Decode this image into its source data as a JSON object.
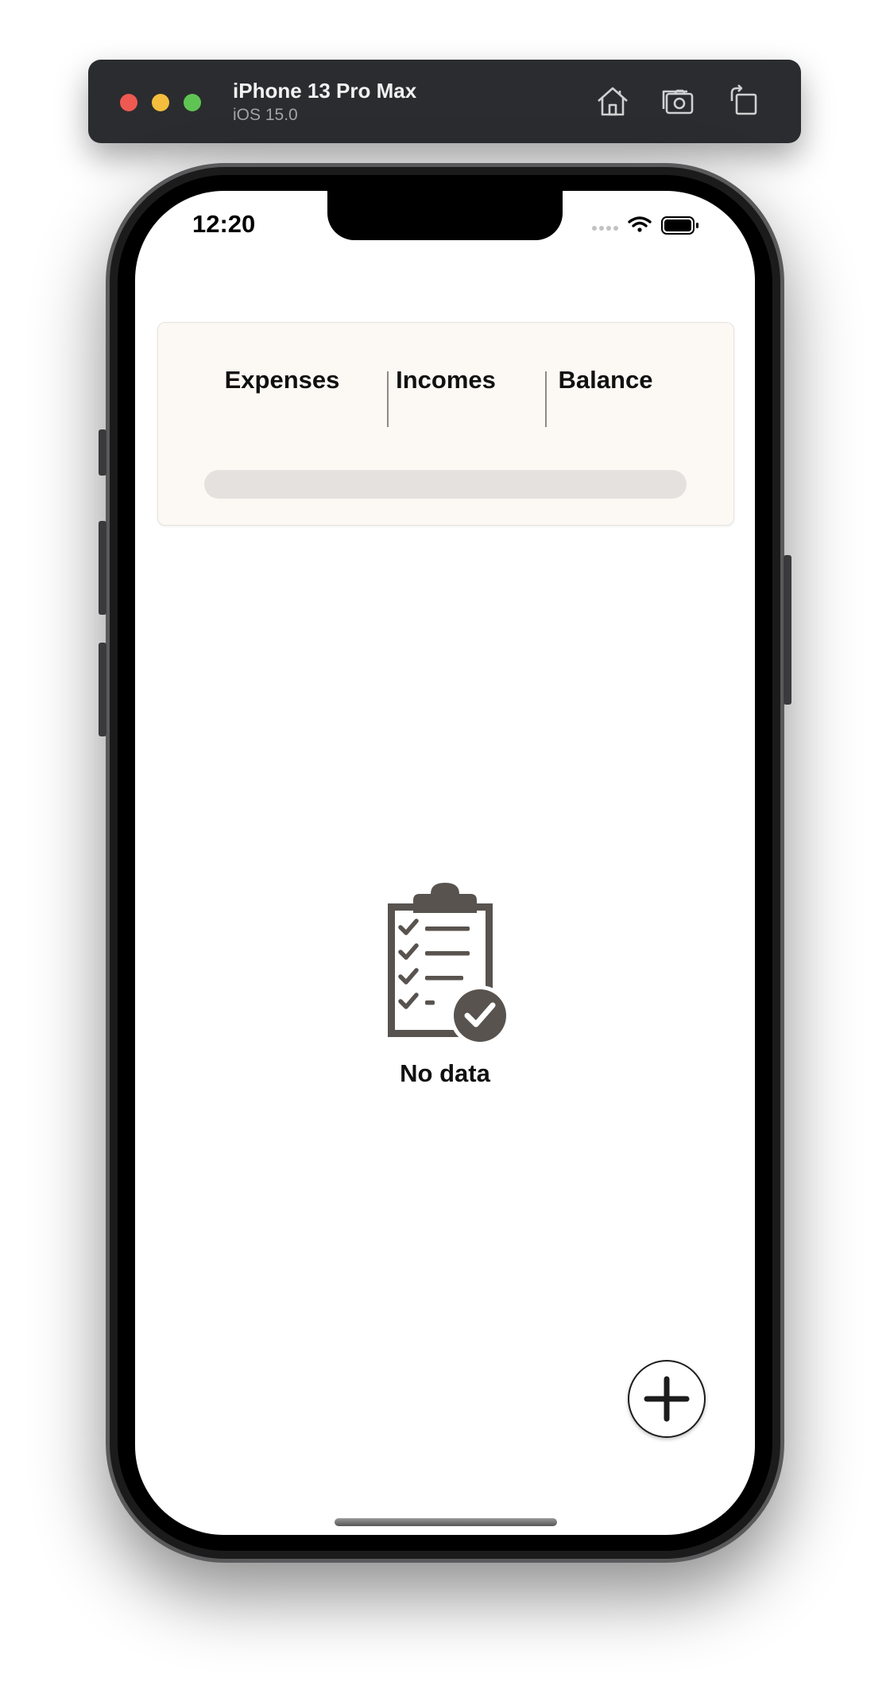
{
  "simulator": {
    "device_name": "iPhone 13 Pro Max",
    "os_version": "iOS 15.0",
    "icons": [
      "home-icon",
      "screenshot-icon",
      "rotate-icon"
    ]
  },
  "status_bar": {
    "time": "12:20"
  },
  "summary": {
    "expenses_label": "Expenses",
    "incomes_label": "Incomes",
    "balance_label": "Balance",
    "progress_fraction": 0
  },
  "empty_state": {
    "icon": "clipboard-check-icon",
    "message": "No data"
  },
  "fab": {
    "icon": "plus-icon"
  },
  "colors": {
    "card_background": "#fcf9f5",
    "progress_track": "#e4e1de",
    "icon_gray": "#58534f"
  }
}
